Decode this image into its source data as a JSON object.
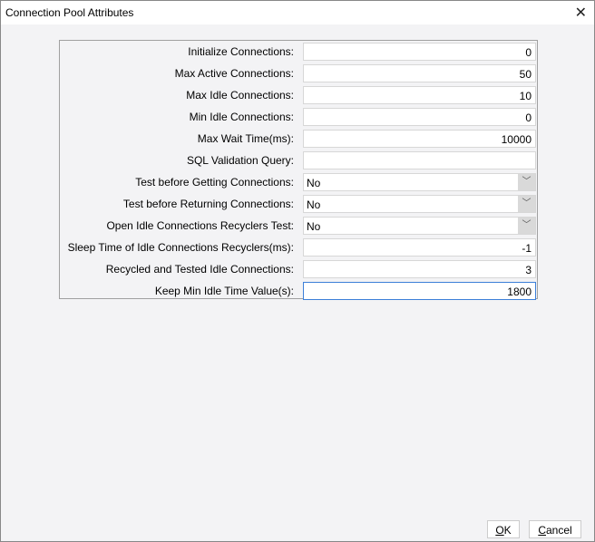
{
  "window": {
    "title": "Connection Pool Attributes"
  },
  "fields": [
    {
      "label": "Initialize Connections:",
      "value": "0",
      "type": "text"
    },
    {
      "label": "Max Active Connections:",
      "value": "50",
      "type": "text"
    },
    {
      "label": "Max Idle Connections:",
      "value": "10",
      "type": "text"
    },
    {
      "label": "Min Idle Connections:",
      "value": "0",
      "type": "text"
    },
    {
      "label": "Max Wait Time(ms):",
      "value": "10000",
      "type": "text"
    },
    {
      "label": "SQL Validation Query:",
      "value": "",
      "type": "text"
    },
    {
      "label": "Test before Getting Connections:",
      "value": "No",
      "type": "select"
    },
    {
      "label": "Test before Returning Connections:",
      "value": "No",
      "type": "select"
    },
    {
      "label": "Open Idle Connections Recyclers Test:",
      "value": "No",
      "type": "select"
    },
    {
      "label": "Sleep Time of Idle Connections Recyclers(ms):",
      "value": "-1",
      "type": "text"
    },
    {
      "label": "Recycled and Tested Idle Connections:",
      "value": "3",
      "type": "text"
    },
    {
      "label": "Keep Min Idle Time Value(s):",
      "value": "1800",
      "type": "text"
    }
  ],
  "buttons": {
    "ok_mnemonic": "O",
    "ok_rest": "K",
    "cancel_mnemonic": "C",
    "cancel_rest": "ancel"
  }
}
